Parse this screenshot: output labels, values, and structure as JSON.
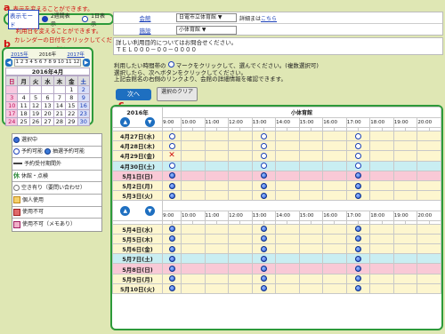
{
  "annotations": {
    "a": "a",
    "b": "b",
    "c": "c"
  },
  "mode": {
    "hint": "表示を変えることができます。",
    "label": "表示モード",
    "two_week": "2週間表示",
    "one_day": "1日表示"
  },
  "day_hint": {
    "line1": "利用日を変えることができます。",
    "line2": "カレンダーの日付をクリックしてください。"
  },
  "nav": {
    "prev_year": "2015年",
    "this_year": "2016年",
    "next_year": "2017年"
  },
  "calendar": {
    "month_title": "2016年4月",
    "weekdays": [
      "日",
      "月",
      "火",
      "水",
      "木",
      "金",
      "土"
    ],
    "weeks": [
      [
        "",
        "",
        "",
        "",
        "",
        "1",
        "2"
      ],
      [
        "3",
        "4",
        "5",
        "6",
        "7",
        "8",
        "9"
      ],
      [
        "10",
        "11",
        "12",
        "13",
        "14",
        "15",
        "16"
      ],
      [
        "17",
        "18",
        "19",
        "20",
        "21",
        "22",
        "23"
      ],
      [
        "24",
        "25",
        "26",
        "27",
        "28",
        "29",
        "30"
      ]
    ]
  },
  "legend": [
    "選択中",
    "予約可能",
    "抽選予約可能",
    "予約受付期間外",
    "休館・点検",
    "空き有り（要問い合わせ）",
    "個人使用",
    "使用不可",
    "使用不可（メモあり）"
  ],
  "facility": {
    "row1_label": "会館",
    "row1_value": "日電市立体育館",
    "row1_detail": "詳細まは",
    "row1_link": "こちら",
    "row2_label": "施設",
    "row2_value": "小体育館"
  },
  "notice": {
    "line1": "詳しい利用目的についてはお問合せください。",
    "line2": "ＴＥＬ０００－００－００００"
  },
  "instructions": {
    "line1": "利用したい時間帯の",
    "line1b": "マークをクリックして、選んでください。(複数選択可)",
    "line2": "選択したら、次へボタンをクリックしてください。",
    "line3": "上記会館名の右側のリンクより、会館の詳細情報を確認できます。"
  },
  "buttons": {
    "next": "次へ",
    "clear": "選択のクリア"
  },
  "schedule": {
    "year_label": "2016年",
    "facility_header": "小体育館",
    "times": [
      "9:00",
      "10:00",
      "11:00",
      "12:00",
      "13:00",
      "14:00",
      "15:00",
      "16:00",
      "17:00",
      "18:00",
      "19:00",
      "20:00"
    ],
    "block1": [
      {
        "date": "4月27日(水)",
        "type": "w",
        "slots": [
          "o",
          "",
          "",
          "",
          "o",
          "",
          "",
          "",
          "o",
          "",
          "",
          ""
        ]
      },
      {
        "date": "4月28日(木)",
        "type": "w",
        "slots": [
          "o",
          "",
          "",
          "",
          "o",
          "",
          "",
          "",
          "o",
          "",
          "",
          ""
        ]
      },
      {
        "date": "4月29日(金)",
        "type": "w",
        "slots": [
          "x",
          "",
          "",
          "",
          "o",
          "",
          "",
          "",
          "o",
          "",
          "",
          ""
        ]
      },
      {
        "date": "4月30日(土)",
        "type": "sat",
        "slots": [
          "o",
          "",
          "",
          "",
          "o",
          "",
          "",
          "",
          "o",
          "",
          "",
          ""
        ]
      },
      {
        "date": "5月1日(日)",
        "type": "sun",
        "slots": [
          "d",
          "",
          "",
          "",
          "d",
          "",
          "",
          "",
          "d",
          "",
          "",
          ""
        ]
      },
      {
        "date": "5月2日(月)",
        "type": "w",
        "slots": [
          "d",
          "",
          "",
          "",
          "d",
          "",
          "",
          "",
          "d",
          "",
          "",
          ""
        ]
      },
      {
        "date": "5月3日(火)",
        "type": "w",
        "slots": [
          "d",
          "",
          "",
          "",
          "d",
          "",
          "",
          "",
          "d",
          "",
          "",
          ""
        ]
      }
    ],
    "block2": [
      {
        "date": "5月4日(水)",
        "type": "w",
        "slots": [
          "d",
          "",
          "",
          "",
          "d",
          "",
          "",
          "",
          "d",
          "",
          "",
          ""
        ]
      },
      {
        "date": "5月5日(木)",
        "type": "w",
        "slots": [
          "d",
          "",
          "",
          "",
          "d",
          "",
          "",
          "",
          "d",
          "",
          "",
          ""
        ]
      },
      {
        "date": "5月6日(金)",
        "type": "w",
        "slots": [
          "d",
          "",
          "",
          "",
          "d",
          "",
          "",
          "",
          "d",
          "",
          "",
          ""
        ]
      },
      {
        "date": "5月7日(土)",
        "type": "sat",
        "slots": [
          "d",
          "",
          "",
          "",
          "d",
          "",
          "",
          "",
          "d",
          "",
          "",
          ""
        ]
      },
      {
        "date": "5月8日(日)",
        "type": "sun",
        "slots": [
          "d",
          "",
          "",
          "",
          "d",
          "",
          "",
          "",
          "d",
          "",
          "",
          ""
        ]
      },
      {
        "date": "5月9日(月)",
        "type": "w",
        "slots": [
          "d",
          "",
          "",
          "",
          "d",
          "",
          "",
          "",
          "d",
          "",
          "",
          ""
        ]
      },
      {
        "date": "5月10日(火)",
        "type": "w",
        "slots": [
          "d",
          "",
          "",
          "",
          "d",
          "",
          "",
          "",
          "d",
          "",
          "",
          ""
        ]
      }
    ]
  }
}
